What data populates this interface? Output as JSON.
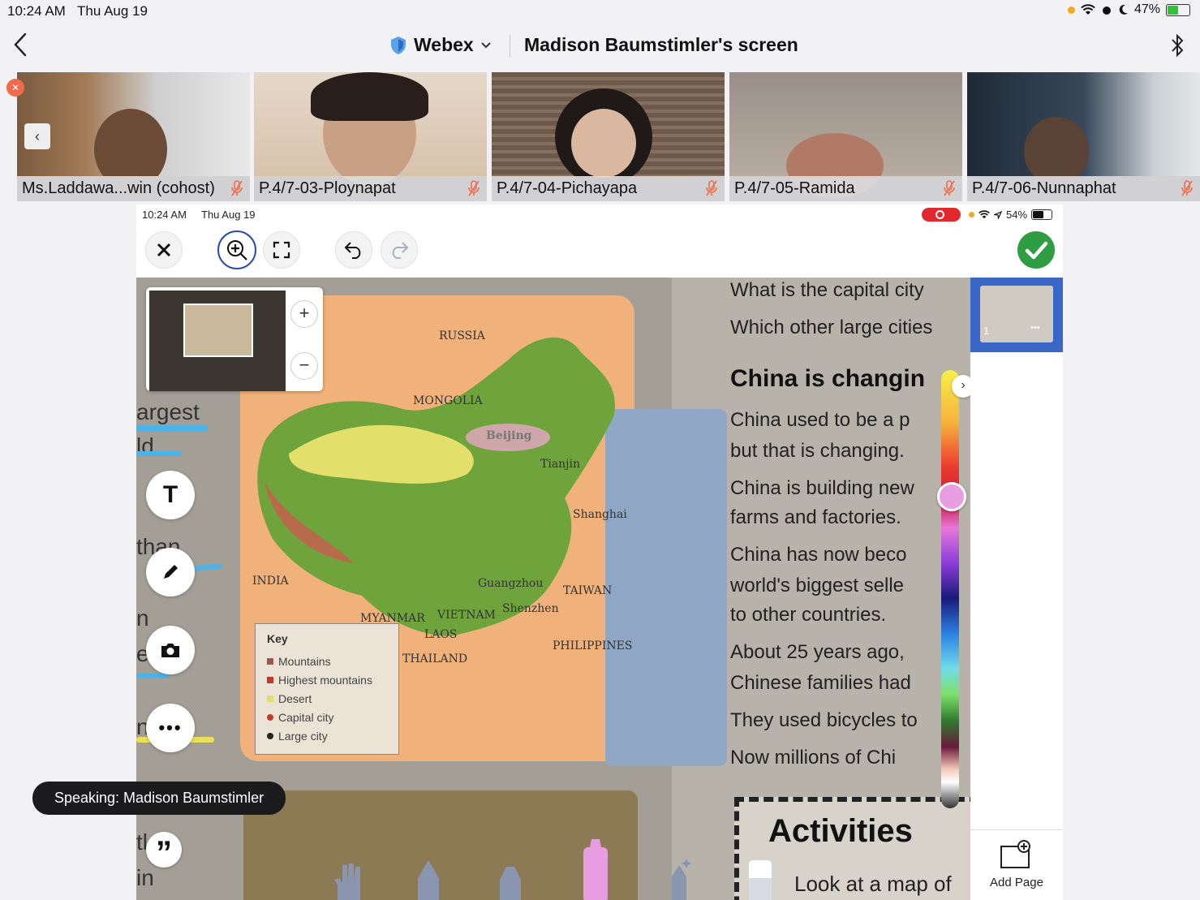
{
  "status_bar": {
    "time": "10:24 AM",
    "date": "Thu Aug 19",
    "battery": "47%",
    "battery_level": 0.47
  },
  "header": {
    "app_name": "Webex",
    "title": "Madison Baumstimler's screen"
  },
  "participants": [
    {
      "name": "Ms.Laddawa...win (cohost)",
      "muted": true
    },
    {
      "name": "P.4/7-03-Ploynapat",
      "muted": true
    },
    {
      "name": "P.4/7-04-Pichayapa",
      "muted": true
    },
    {
      "name": "P.4/7-05-Ramida",
      "muted": true
    },
    {
      "name": "P.4/7-06-Nunnaphat",
      "muted": true
    }
  ],
  "shared_screen": {
    "status": {
      "time": "10:24 AM",
      "date": "Thu Aug 19",
      "battery": "54%",
      "battery_level": 0.54
    },
    "map": {
      "labels": {
        "russia": "RUSSIA",
        "mongolia": "MONGOLIA",
        "beijing": "Beijing",
        "tianjin": "Tianjin",
        "shanghai": "Shanghai",
        "india": "INDIA",
        "guangzhou": "Guangzhou",
        "shenzhen": "Shenzhen",
        "taiwan": "TAIWAN",
        "myanmar": "MYANMAR",
        "vietnam": "VIETNAM",
        "laos": "LAOS",
        "thailand": "THAILAND",
        "philippines": "PHILIPPINES"
      },
      "key": {
        "title": "Key",
        "items": [
          "Mountains",
          "Highest mountains",
          "Desert",
          "Capital city",
          "Large city"
        ]
      }
    },
    "left_margin_words": [
      "argest",
      "ld",
      "than",
      "n",
      "e",
      "n",
      "ive",
      "tl",
      "in"
    ],
    "book_text": {
      "line1": "What is the capital city",
      "line2": "Which other large cities",
      "heading": "China is changin",
      "p1a": "China used to be a p",
      "p1b": "but that is changing.",
      "p2a": "China is building new",
      "p2b": "farms and factories.",
      "p3a": "China has now beco",
      "p3b": "world's biggest selle",
      "p3c": "to other countries.",
      "p4a": "About 25 years ago,",
      "p4b": "Chinese families had",
      "p5a": "They used bicycles to",
      "p5b": "Now millions of Chi",
      "activities_title": "Activities",
      "activities_text": "Look at a map of"
    },
    "page_rail": {
      "page_number": "1",
      "more": "•••",
      "add_page": "Add Page"
    }
  },
  "speaking": "Speaking: Madison Baumstimler",
  "colors": {
    "accent_blue": "#2a4fa8",
    "done_green": "#2f9e42",
    "mute_red": "#f26b4a",
    "rec_red": "#e0282e"
  }
}
